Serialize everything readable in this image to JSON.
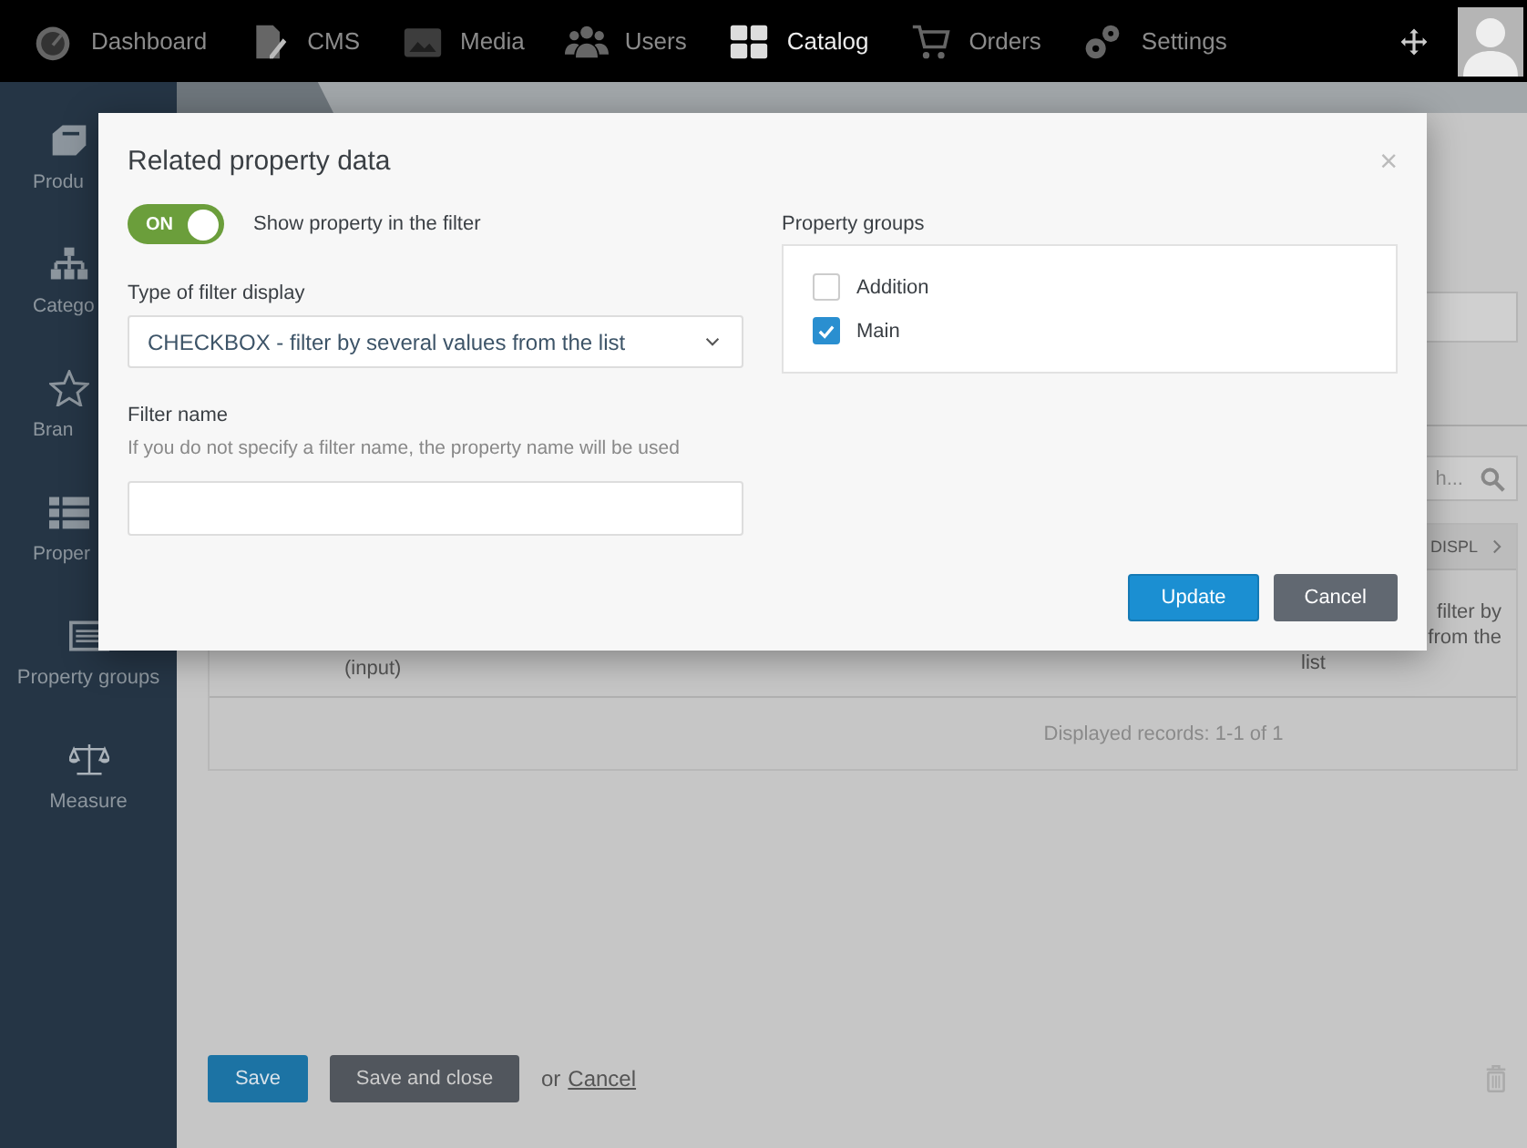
{
  "topnav": {
    "items": [
      {
        "label": "Dashboard",
        "selected": false
      },
      {
        "label": "CMS",
        "selected": false
      },
      {
        "label": "Media",
        "selected": false
      },
      {
        "label": "Users",
        "selected": false
      },
      {
        "label": "Catalog",
        "selected": true
      },
      {
        "label": "Orders",
        "selected": false
      },
      {
        "label": "Settings",
        "selected": false
      }
    ]
  },
  "sidebar": {
    "items": [
      {
        "label": "Produ"
      },
      {
        "label": "Catego"
      },
      {
        "label": "Bran"
      },
      {
        "label": "Proper"
      },
      {
        "label": "Property groups"
      },
      {
        "label": "Measure"
      }
    ]
  },
  "background": {
    "search_value": "h...",
    "column_header": "DISPL",
    "row": {
      "cell_1": "(input)",
      "cell_2_lines": [
        "filter by",
        "from the",
        "list"
      ]
    },
    "records": "Displayed records: 1-1 of 1"
  },
  "footer": {
    "save": "Save",
    "save_close": "Save and close",
    "or": "or",
    "cancel": "Cancel"
  },
  "modal": {
    "title": "Related property data",
    "close": "×",
    "toggle": {
      "text": "ON",
      "on": true,
      "label": "Show property in the filter"
    },
    "filter_type": {
      "label": "Type of filter display",
      "value": "CHECKBOX - filter by several values from the list"
    },
    "filter_name": {
      "label": "Filter name",
      "hint": "If you do not specify a filter name, the property name will be used"
    },
    "groups": {
      "label": "Property groups",
      "items": [
        {
          "label": "Addition",
          "checked": false
        },
        {
          "label": "Main",
          "checked": true
        }
      ]
    },
    "buttons": {
      "update": "Update",
      "cancel": "Cancel"
    }
  }
}
